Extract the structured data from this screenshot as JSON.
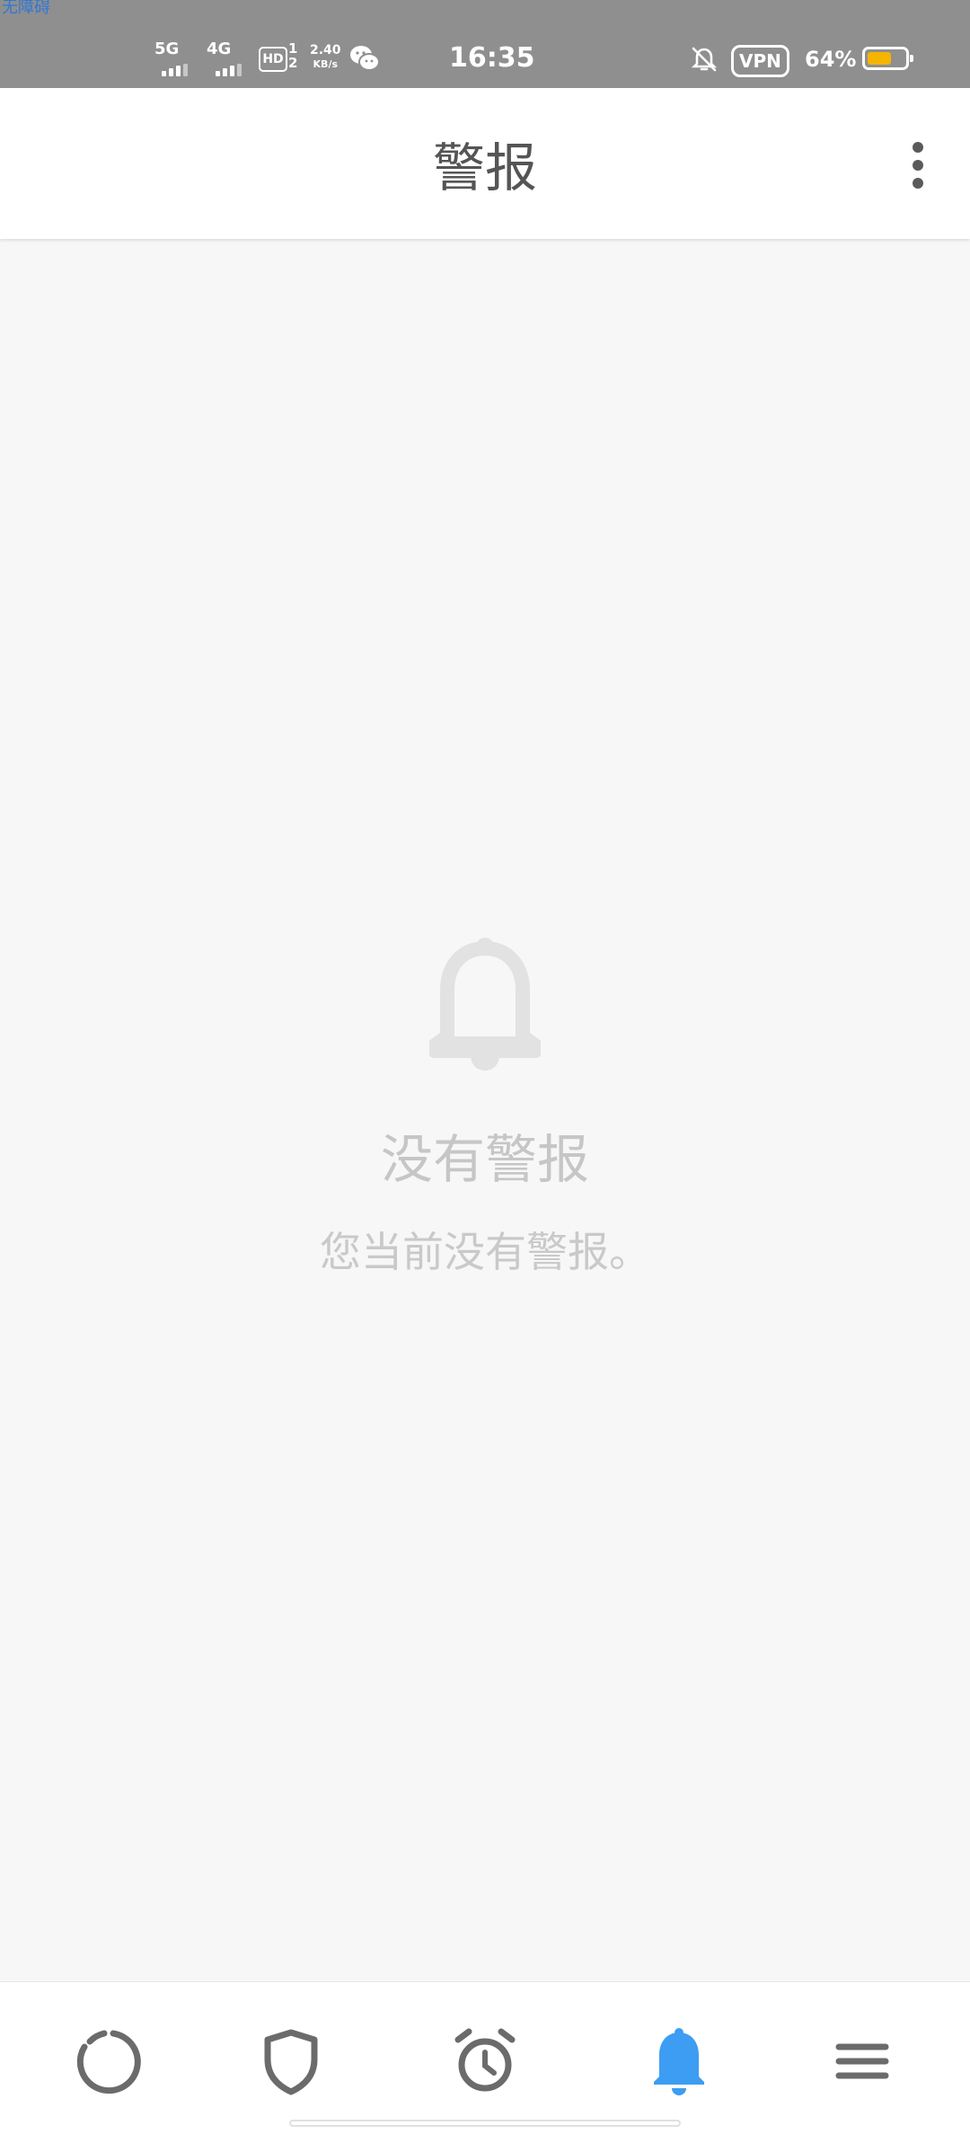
{
  "status_bar": {
    "corner_label": "无障碍",
    "signal_1": "5G",
    "signal_2": "4G",
    "hd_label": "HD",
    "hd_sub": "1\n2",
    "speed_value": "2.40",
    "speed_unit": "KB/s",
    "time": "16:35",
    "vpn_label": "VPN",
    "battery_text": "64%",
    "battery_level": 0.64,
    "icons": [
      "mute-bell-icon",
      "wechat-icon"
    ]
  },
  "app_bar": {
    "title": "警报",
    "menu_icon": "more-vertical-icon"
  },
  "empty_state": {
    "icon": "bell-icon",
    "title": "没有警报",
    "subtitle": "您当前没有警报。"
  },
  "bottom_nav": {
    "active_index": 3,
    "active_color": "#3d9df2",
    "inactive_color": "#6b6b6b",
    "items": [
      {
        "name": "dashboard",
        "icon": "circle-progress-icon"
      },
      {
        "name": "protection",
        "icon": "shield-icon"
      },
      {
        "name": "schedule",
        "icon": "alarm-clock-icon"
      },
      {
        "name": "alerts",
        "icon": "bell-icon"
      },
      {
        "name": "menu",
        "icon": "hamburger-icon"
      }
    ]
  }
}
